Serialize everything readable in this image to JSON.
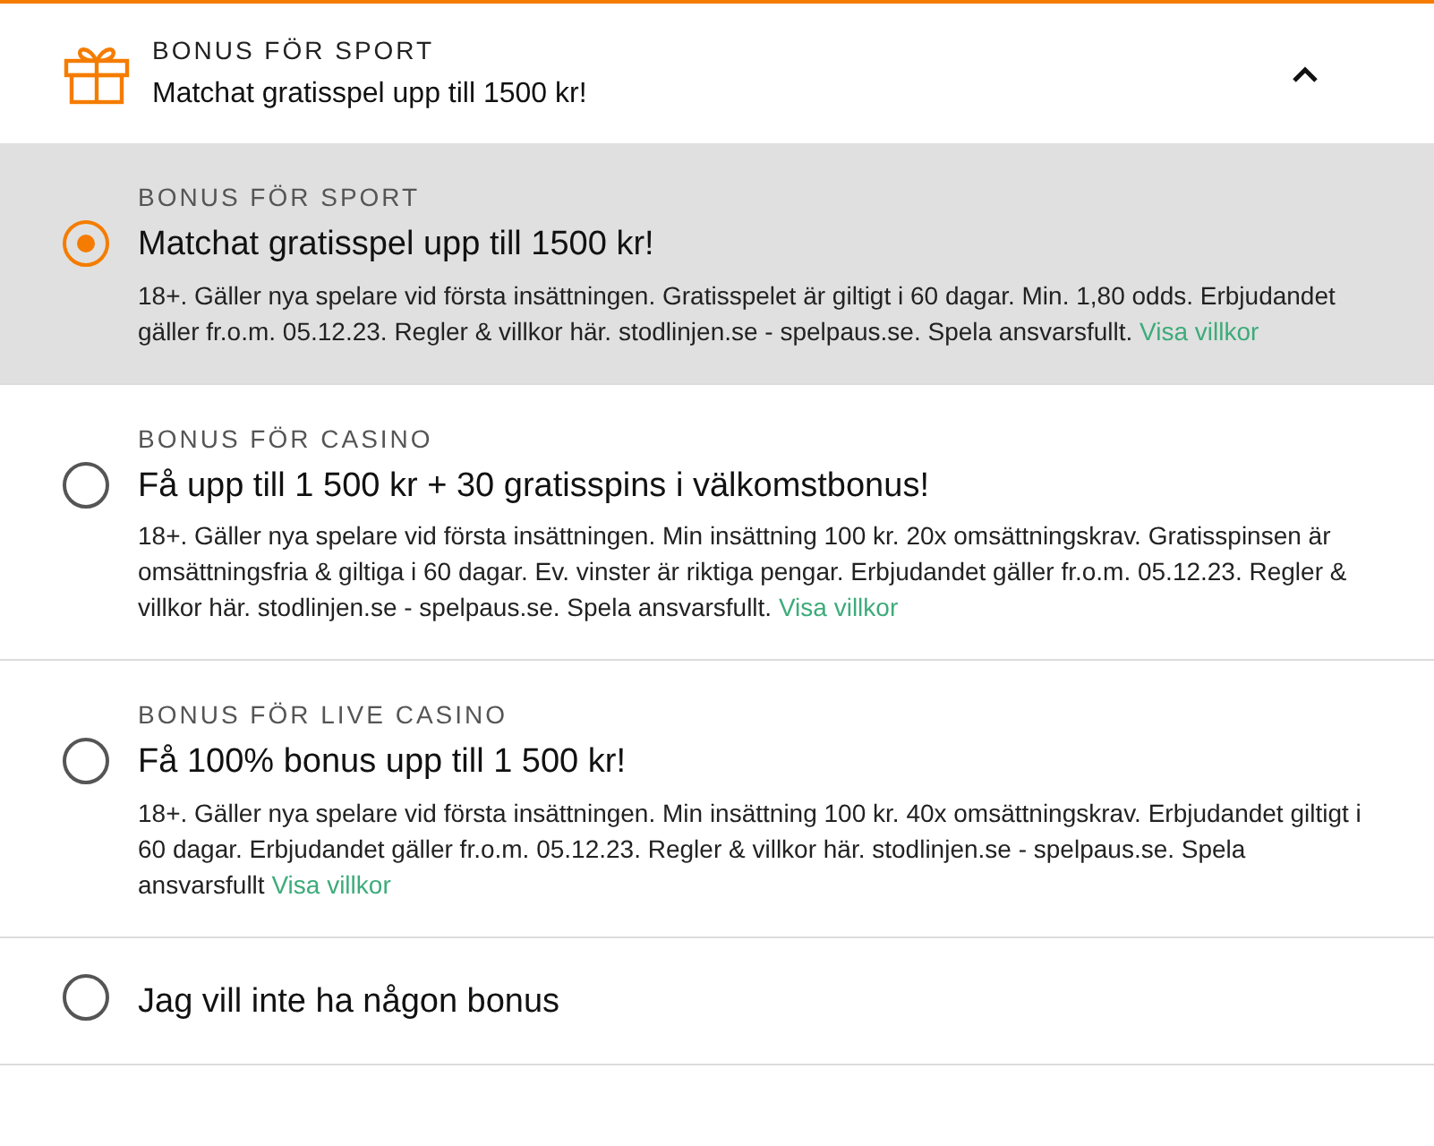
{
  "header": {
    "label": "BONUS FÖR SPORT",
    "title": "Matchat gratisspel upp till 1500 kr!",
    "expanded": true
  },
  "options": [
    {
      "label": "BONUS FÖR SPORT",
      "title": "Matchat gratisspel upp till 1500 kr!",
      "description": "18+. Gäller nya spelare vid första insättningen. Gratisspelet är giltigt i 60 dagar. Min. 1,80 odds. Erbjudandet gäller fr.o.m. 05.12.23. Regler & villkor här. stodlinjen.se - spelpaus.se. Spela ansvarsfullt.",
      "link": "Visa villkor",
      "selected": true
    },
    {
      "label": "BONUS FÖR CASINO",
      "title": "Få upp till 1 500 kr + 30 gratisspins i välkomstbonus!",
      "description": "18+. Gäller nya spelare vid första insättningen. Min insättning 100 kr. 20x omsättningskrav. Gratisspinsen är omsättningsfria & giltiga i 60 dagar. Ev. vinster är riktiga pengar. Erbjudandet gäller fr.o.m. 05.12.23. Regler & villkor här. stodlinjen.se - spelpaus.se. Spela ansvarsfullt.",
      "link": "Visa villkor",
      "selected": false
    },
    {
      "label": "BONUS FÖR LIVE CASINO",
      "title": "Få 100% bonus upp till 1 500 kr!",
      "description": "18+. Gäller nya spelare vid första insättningen. Min insättning 100 kr. 40x omsättningskrav. Erbjudandet giltigt i 60 dagar. Erbjudandet gäller fr.o.m. 05.12.23. Regler & villkor här. stodlinjen.se - spelpaus.se. Spela ansvarsfullt",
      "link": "Visa villkor",
      "selected": false
    },
    {
      "title": "Jag vill inte ha någon bonus",
      "selected": false
    }
  ]
}
